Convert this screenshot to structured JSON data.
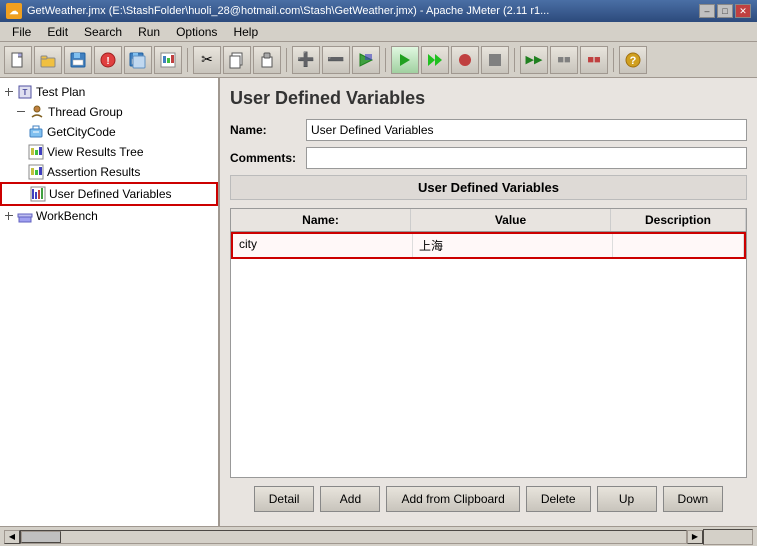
{
  "titleBar": {
    "icon": "☁",
    "text": "GetWeather.jmx (E:\\StashFolder\\huoli_28@hotmail.com\\Stash\\GetWeather.jmx) - Apache JMeter (2.11 r1...",
    "minimize": "–",
    "maximize": "□",
    "close": "✕"
  },
  "menu": {
    "items": [
      "File",
      "Edit",
      "Search",
      "Run",
      "Options",
      "Help"
    ]
  },
  "toolbar": {
    "buttons": [
      "📄",
      "📂",
      "💾",
      "🚫",
      "💾",
      "📊",
      "✂",
      "📋",
      "📋",
      "➕",
      "➖",
      "⚡",
      "▶",
      "▶",
      "⏺",
      "⏹",
      "▶",
      "⏭",
      "⏭",
      "🔧"
    ]
  },
  "tree": {
    "items": [
      {
        "label": "Test Plan",
        "indent": 0,
        "icon": "📋"
      },
      {
        "label": "Thread Group",
        "indent": 1,
        "icon": "👥"
      },
      {
        "label": "GetCityCode",
        "indent": 2,
        "icon": "🔧"
      },
      {
        "label": "View Results Tree",
        "indent": 2,
        "icon": "📊"
      },
      {
        "label": "Assertion Results",
        "indent": 2,
        "icon": "📊"
      },
      {
        "label": "User Defined Variables",
        "indent": 2,
        "icon": "📊",
        "selected": true
      },
      {
        "label": "WorkBench",
        "indent": 0,
        "icon": "🔨"
      }
    ]
  },
  "panel": {
    "title": "User Defined Variables",
    "nameLabel": "Name:",
    "nameValue": "User Defined Variables",
    "commentsLabel": "Comments:",
    "tableTitle": "User Defined Variables",
    "columns": [
      "Name:",
      "Value",
      "Description"
    ],
    "rows": [
      {
        "name": "city",
        "value": "上海",
        "description": "",
        "selected": true
      }
    ]
  },
  "buttons": {
    "detail": "Detail",
    "add": "Add",
    "addFromClipboard": "Add from Clipboard",
    "delete": "Delete",
    "up": "Up",
    "down": "Down"
  },
  "statusBar": {
    "left": "",
    "right": ""
  }
}
